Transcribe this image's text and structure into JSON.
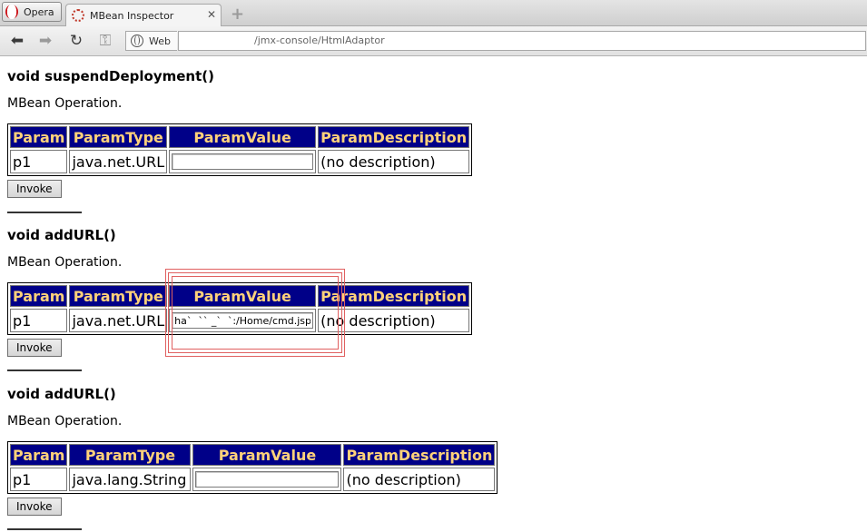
{
  "browser": {
    "menu_label": "Opera",
    "tab_title": "MBean Inspector",
    "tab_close": "✕",
    "new_tab": "+",
    "address_scheme": "Web",
    "address_url": "/jmx-console/HtmlAdaptor"
  },
  "operations": [
    {
      "title": "void suspendDeployment()",
      "description": "MBean Operation.",
      "headers": [
        "Param",
        "ParamType",
        "ParamValue",
        "ParamDescription"
      ],
      "param": "p1",
      "type": "java.net.URL",
      "value": "",
      "param_description": "(no description)",
      "invoke_label": "Invoke"
    },
    {
      "title": "void addURL()",
      "description": "MBean Operation.",
      "headers": [
        "Param",
        "ParamType",
        "ParamValue",
        "ParamDescription"
      ],
      "param": "p1",
      "type": "java.net.URL",
      "value": "ha`  `` _`  `:/Home/cmd.jsp",
      "param_description": "(no description)",
      "invoke_label": "Invoke"
    },
    {
      "title": "void addURL()",
      "description": "MBean Operation.",
      "headers": [
        "Param",
        "ParamType",
        "ParamValue",
        "ParamDescription"
      ],
      "param": "p1",
      "type": "java.lang.String",
      "value": "",
      "param_description": "(no description)",
      "invoke_label": "Invoke"
    }
  ],
  "colors": {
    "header_bg": "#000088",
    "header_text": "#ffd27a",
    "highlight": "#e06060"
  }
}
